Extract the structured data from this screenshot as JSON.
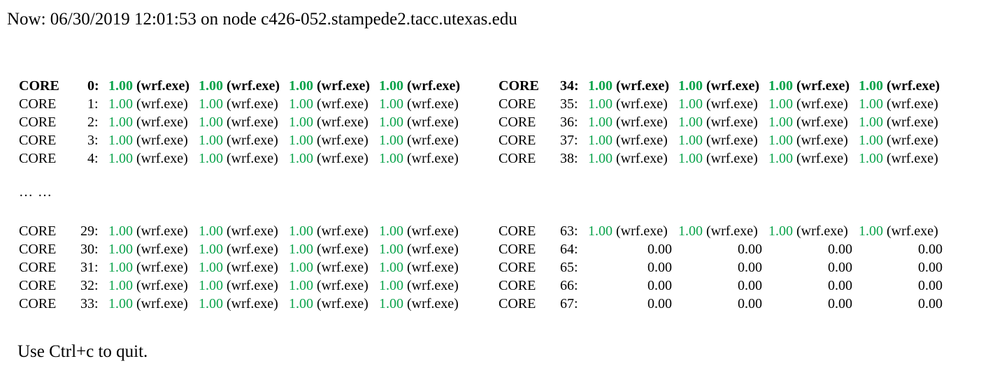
{
  "header": {
    "status_line": "Now: 06/30/2019 12:01:53 on node c426-052.stampede2.tacc.utexas.edu"
  },
  "footer": {
    "hint": "Use Ctrl+c to quit."
  },
  "separator": {
    "ellipsis": "… …"
  },
  "colors": {
    "active_load": "#0aa34b",
    "idle_load": "#000000",
    "text": "#000000",
    "background": "#ffffff"
  },
  "table": {
    "core_label": "CORE",
    "colon": ":",
    "process_name": "(wrf.exe)",
    "active_value": "1.00",
    "idle_value": "0.00",
    "columns": [
      {
        "name": "left-column",
        "groups": [
          {
            "name": "top-group",
            "rows": [
              {
                "index": "0",
                "bold": true,
                "cells": [
                  {
                    "value": "1.00",
                    "process": "(wrf.exe)",
                    "idle": false
                  },
                  {
                    "value": "1.00",
                    "process": "(wrf.exe)",
                    "idle": false
                  },
                  {
                    "value": "1.00",
                    "process": "(wrf.exe)",
                    "idle": false
                  },
                  {
                    "value": "1.00",
                    "process": "(wrf.exe)",
                    "idle": false
                  }
                ]
              },
              {
                "index": "1",
                "bold": false,
                "cells": [
                  {
                    "value": "1.00",
                    "process": "(wrf.exe)",
                    "idle": false
                  },
                  {
                    "value": "1.00",
                    "process": "(wrf.exe)",
                    "idle": false
                  },
                  {
                    "value": "1.00",
                    "process": "(wrf.exe)",
                    "idle": false
                  },
                  {
                    "value": "1.00",
                    "process": "(wrf.exe)",
                    "idle": false
                  }
                ]
              },
              {
                "index": "2",
                "bold": false,
                "cells": [
                  {
                    "value": "1.00",
                    "process": "(wrf.exe)",
                    "idle": false
                  },
                  {
                    "value": "1.00",
                    "process": "(wrf.exe)",
                    "idle": false
                  },
                  {
                    "value": "1.00",
                    "process": "(wrf.exe)",
                    "idle": false
                  },
                  {
                    "value": "1.00",
                    "process": "(wrf.exe)",
                    "idle": false
                  }
                ]
              },
              {
                "index": "3",
                "bold": false,
                "cells": [
                  {
                    "value": "1.00",
                    "process": "(wrf.exe)",
                    "idle": false
                  },
                  {
                    "value": "1.00",
                    "process": "(wrf.exe)",
                    "idle": false
                  },
                  {
                    "value": "1.00",
                    "process": "(wrf.exe)",
                    "idle": false
                  },
                  {
                    "value": "1.00",
                    "process": "(wrf.exe)",
                    "idle": false
                  }
                ]
              },
              {
                "index": "4",
                "bold": false,
                "cells": [
                  {
                    "value": "1.00",
                    "process": "(wrf.exe)",
                    "idle": false
                  },
                  {
                    "value": "1.00",
                    "process": "(wrf.exe)",
                    "idle": false
                  },
                  {
                    "value": "1.00",
                    "process": "(wrf.exe)",
                    "idle": false
                  },
                  {
                    "value": "1.00",
                    "process": "(wrf.exe)",
                    "idle": false
                  }
                ]
              }
            ]
          },
          {
            "name": "bottom-group",
            "rows": [
              {
                "index": "29",
                "bold": false,
                "cells": [
                  {
                    "value": "1.00",
                    "process": "(wrf.exe)",
                    "idle": false
                  },
                  {
                    "value": "1.00",
                    "process": "(wrf.exe)",
                    "idle": false
                  },
                  {
                    "value": "1.00",
                    "process": "(wrf.exe)",
                    "idle": false
                  },
                  {
                    "value": "1.00",
                    "process": "(wrf.exe)",
                    "idle": false
                  }
                ]
              },
              {
                "index": "30",
                "bold": false,
                "cells": [
                  {
                    "value": "1.00",
                    "process": "(wrf.exe)",
                    "idle": false
                  },
                  {
                    "value": "1.00",
                    "process": "(wrf.exe)",
                    "idle": false
                  },
                  {
                    "value": "1.00",
                    "process": "(wrf.exe)",
                    "idle": false
                  },
                  {
                    "value": "1.00",
                    "process": "(wrf.exe)",
                    "idle": false
                  }
                ]
              },
              {
                "index": "31",
                "bold": false,
                "cells": [
                  {
                    "value": "1.00",
                    "process": "(wrf.exe)",
                    "idle": false
                  },
                  {
                    "value": "1.00",
                    "process": "(wrf.exe)",
                    "idle": false
                  },
                  {
                    "value": "1.00",
                    "process": "(wrf.exe)",
                    "idle": false
                  },
                  {
                    "value": "1.00",
                    "process": "(wrf.exe)",
                    "idle": false
                  }
                ]
              },
              {
                "index": "32",
                "bold": false,
                "cells": [
                  {
                    "value": "1.00",
                    "process": "(wrf.exe)",
                    "idle": false
                  },
                  {
                    "value": "1.00",
                    "process": "(wrf.exe)",
                    "idle": false
                  },
                  {
                    "value": "1.00",
                    "process": "(wrf.exe)",
                    "idle": false
                  },
                  {
                    "value": "1.00",
                    "process": "(wrf.exe)",
                    "idle": false
                  }
                ]
              },
              {
                "index": "33",
                "bold": false,
                "cells": [
                  {
                    "value": "1.00",
                    "process": "(wrf.exe)",
                    "idle": false
                  },
                  {
                    "value": "1.00",
                    "process": "(wrf.exe)",
                    "idle": false
                  },
                  {
                    "value": "1.00",
                    "process": "(wrf.exe)",
                    "idle": false
                  },
                  {
                    "value": "1.00",
                    "process": "(wrf.exe)",
                    "idle": false
                  }
                ]
              }
            ]
          }
        ]
      },
      {
        "name": "right-column",
        "groups": [
          {
            "name": "top-group",
            "rows": [
              {
                "index": "34",
                "bold": true,
                "cells": [
                  {
                    "value": "1.00",
                    "process": "(wrf.exe)",
                    "idle": false
                  },
                  {
                    "value": "1.00",
                    "process": "(wrf.exe)",
                    "idle": false
                  },
                  {
                    "value": "1.00",
                    "process": "(wrf.exe)",
                    "idle": false
                  },
                  {
                    "value": "1.00",
                    "process": "(wrf.exe)",
                    "idle": false
                  }
                ]
              },
              {
                "index": "35",
                "bold": false,
                "cells": [
                  {
                    "value": "1.00",
                    "process": "(wrf.exe)",
                    "idle": false
                  },
                  {
                    "value": "1.00",
                    "process": "(wrf.exe)",
                    "idle": false
                  },
                  {
                    "value": "1.00",
                    "process": "(wrf.exe)",
                    "idle": false
                  },
                  {
                    "value": "1.00",
                    "process": "(wrf.exe)",
                    "idle": false
                  }
                ]
              },
              {
                "index": "36",
                "bold": false,
                "cells": [
                  {
                    "value": "1.00",
                    "process": "(wrf.exe)",
                    "idle": false
                  },
                  {
                    "value": "1.00",
                    "process": "(wrf.exe)",
                    "idle": false
                  },
                  {
                    "value": "1.00",
                    "process": "(wrf.exe)",
                    "idle": false
                  },
                  {
                    "value": "1.00",
                    "process": "(wrf.exe)",
                    "idle": false
                  }
                ]
              },
              {
                "index": "37",
                "bold": false,
                "cells": [
                  {
                    "value": "1.00",
                    "process": "(wrf.exe)",
                    "idle": false
                  },
                  {
                    "value": "1.00",
                    "process": "(wrf.exe)",
                    "idle": false
                  },
                  {
                    "value": "1.00",
                    "process": "(wrf.exe)",
                    "idle": false
                  },
                  {
                    "value": "1.00",
                    "process": "(wrf.exe)",
                    "idle": false
                  }
                ]
              },
              {
                "index": "38",
                "bold": false,
                "cells": [
                  {
                    "value": "1.00",
                    "process": "(wrf.exe)",
                    "idle": false
                  },
                  {
                    "value": "1.00",
                    "process": "(wrf.exe)",
                    "idle": false
                  },
                  {
                    "value": "1.00",
                    "process": "(wrf.exe)",
                    "idle": false
                  },
                  {
                    "value": "1.00",
                    "process": "(wrf.exe)",
                    "idle": false
                  }
                ]
              }
            ]
          },
          {
            "name": "bottom-group",
            "rows": [
              {
                "index": "63",
                "bold": false,
                "cells": [
                  {
                    "value": "1.00",
                    "process": "(wrf.exe)",
                    "idle": false
                  },
                  {
                    "value": "1.00",
                    "process": "(wrf.exe)",
                    "idle": false
                  },
                  {
                    "value": "1.00",
                    "process": "(wrf.exe)",
                    "idle": false
                  },
                  {
                    "value": "1.00",
                    "process": "(wrf.exe)",
                    "idle": false
                  }
                ]
              },
              {
                "index": "64",
                "bold": false,
                "cells": [
                  {
                    "value": "0.00",
                    "process": "",
                    "idle": true
                  },
                  {
                    "value": "0.00",
                    "process": "",
                    "idle": true
                  },
                  {
                    "value": "0.00",
                    "process": "",
                    "idle": true
                  },
                  {
                    "value": "0.00",
                    "process": "",
                    "idle": true
                  }
                ]
              },
              {
                "index": "65",
                "bold": false,
                "cells": [
                  {
                    "value": "0.00",
                    "process": "",
                    "idle": true
                  },
                  {
                    "value": "0.00",
                    "process": "",
                    "idle": true
                  },
                  {
                    "value": "0.00",
                    "process": "",
                    "idle": true
                  },
                  {
                    "value": "0.00",
                    "process": "",
                    "idle": true
                  }
                ]
              },
              {
                "index": "66",
                "bold": false,
                "cells": [
                  {
                    "value": "0.00",
                    "process": "",
                    "idle": true
                  },
                  {
                    "value": "0.00",
                    "process": "",
                    "idle": true
                  },
                  {
                    "value": "0.00",
                    "process": "",
                    "idle": true
                  },
                  {
                    "value": "0.00",
                    "process": "",
                    "idle": true
                  }
                ]
              },
              {
                "index": "67",
                "bold": false,
                "cells": [
                  {
                    "value": "0.00",
                    "process": "",
                    "idle": true
                  },
                  {
                    "value": "0.00",
                    "process": "",
                    "idle": true
                  },
                  {
                    "value": "0.00",
                    "process": "",
                    "idle": true
                  },
                  {
                    "value": "0.00",
                    "process": "",
                    "idle": true
                  }
                ]
              }
            ]
          }
        ]
      }
    ]
  }
}
